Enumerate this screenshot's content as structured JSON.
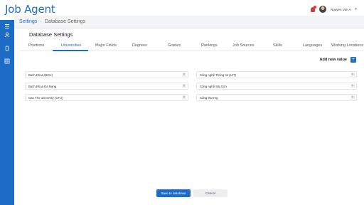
{
  "app": {
    "title": "Job Agent"
  },
  "user": {
    "name": "Nguyen Van A"
  },
  "breadcrumb": {
    "root": "Settings",
    "separator": "·",
    "current": "Database Settings"
  },
  "card": {
    "title": "Database Settings"
  },
  "tabs": [
    {
      "label": "Positions",
      "active": false
    },
    {
      "label": "Universities",
      "active": true
    },
    {
      "label": "Major Fields",
      "active": false
    },
    {
      "label": "Degrees",
      "active": false
    },
    {
      "label": "Grades",
      "active": false
    },
    {
      "label": "Rankings",
      "active": false
    },
    {
      "label": "Job Sources",
      "active": false
    },
    {
      "label": "Skills",
      "active": false
    },
    {
      "label": "Languages",
      "active": false
    },
    {
      "label": "Working Locations",
      "active": false
    }
  ],
  "actions": {
    "add_new_value": "Add new value",
    "add_icon": "+"
  },
  "values_left": [
    {
      "label": "Bach Khoa (BKU)"
    },
    {
      "label": "Bach Khoa Da Nang"
    },
    {
      "label": "Can Tho university (CTU)"
    }
  ],
  "values_right": [
    {
      "label": "Công nghệ Thông tin (UIT)"
    },
    {
      "label": "Công nghệ Sài Gòn"
    },
    {
      "label": "Công thương"
    }
  ],
  "footer": {
    "save_label": "Save to database",
    "cancel_label": "Cancel"
  },
  "colors": {
    "accent": "#1c6cc5",
    "sidebar": "#1c6cc5"
  }
}
